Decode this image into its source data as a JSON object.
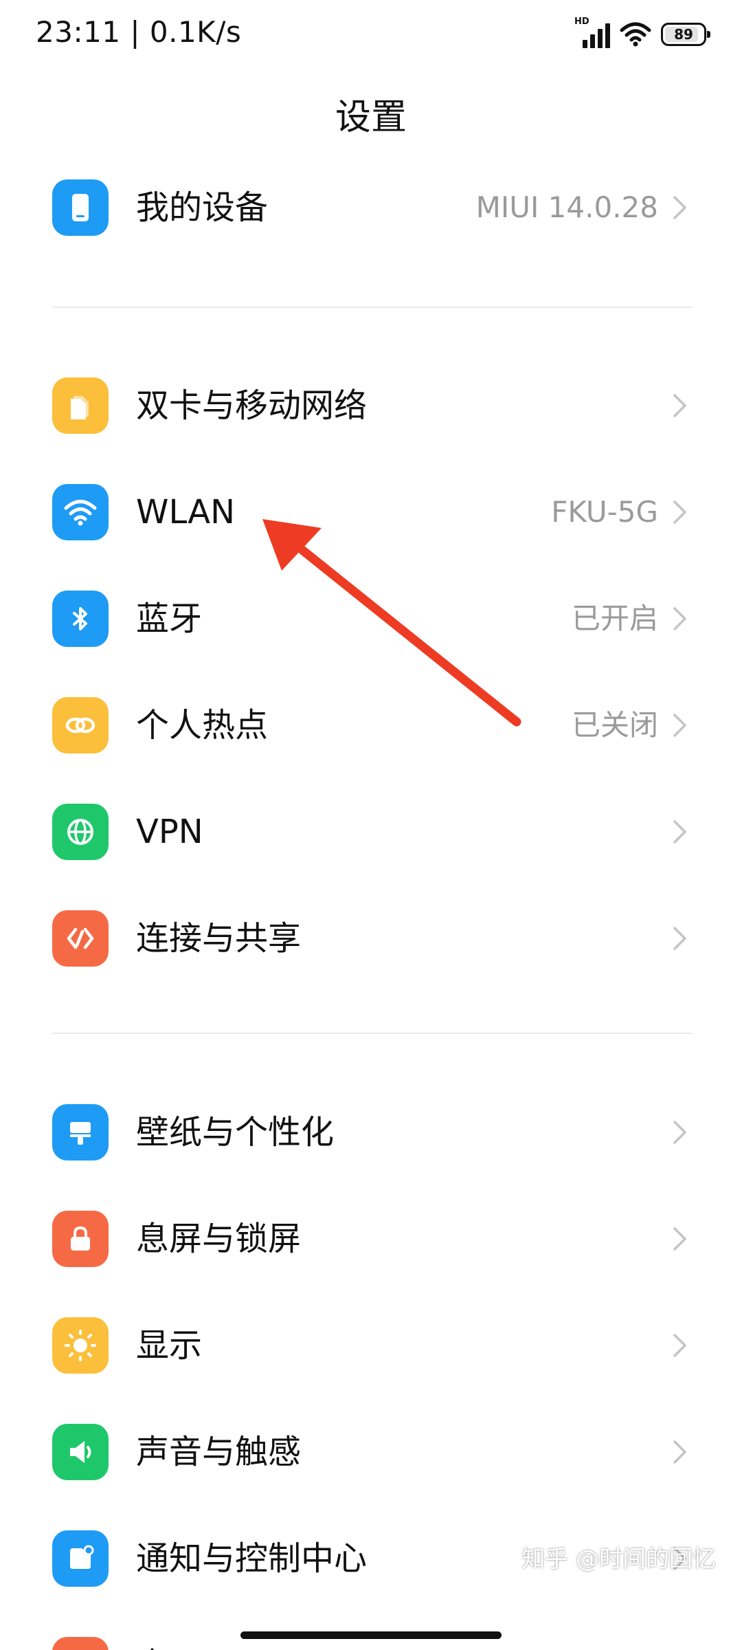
{
  "status_bar": {
    "time_speed": "23:11 | 0.1K/s",
    "network_label": "HD",
    "battery_level": "89",
    "battery_fraction": 0.89
  },
  "header": {
    "title": "设置"
  },
  "groups": [
    {
      "items": [
        {
          "id": "my-device",
          "label": "我的设备",
          "value": "MIUI 14.0.28",
          "icon": "phone-icon",
          "color": "#1E9BF5"
        }
      ]
    },
    {
      "items": [
        {
          "id": "sim-network",
          "label": "双卡与移动网络",
          "value": "",
          "icon": "sim-card-icon",
          "color": "#FBBF3C"
        },
        {
          "id": "wlan",
          "label": "WLAN",
          "value": "FKU-5G",
          "icon": "wifi-icon",
          "color": "#1E9BF5"
        },
        {
          "id": "bluetooth",
          "label": "蓝牙",
          "value": "已开启",
          "icon": "bluetooth-icon",
          "color": "#1E9BF5"
        },
        {
          "id": "hotspot",
          "label": "个人热点",
          "value": "已关闭",
          "icon": "hotspot-icon",
          "color": "#FBBF3C"
        },
        {
          "id": "vpn",
          "label": "VPN",
          "value": "",
          "icon": "globe-icon",
          "color": "#1EC86A"
        },
        {
          "id": "connection-sharing",
          "label": "连接与共享",
          "value": "",
          "icon": "share-link-icon",
          "color": "#F56A45"
        }
      ]
    },
    {
      "items": [
        {
          "id": "wallpaper",
          "label": "壁纸与个性化",
          "value": "",
          "icon": "brush-icon",
          "color": "#1E9BF5"
        },
        {
          "id": "lock-screen",
          "label": "息屏与锁屏",
          "value": "",
          "icon": "lock-icon",
          "color": "#F56A45"
        },
        {
          "id": "display",
          "label": "显示",
          "value": "",
          "icon": "sun-icon",
          "color": "#FBBF3C"
        },
        {
          "id": "sound",
          "label": "声音与触感",
          "value": "",
          "icon": "speaker-icon",
          "color": "#1EC86A"
        },
        {
          "id": "notifications",
          "label": "通知与控制中心",
          "value": "",
          "icon": "notification-icon",
          "color": "#1E9BF5"
        },
        {
          "id": "desktop",
          "label": "桌面",
          "value": "",
          "icon": "home-icon",
          "color": "#F56A45"
        }
      ]
    }
  ],
  "annotation": {
    "arrow_color": "#EE3B23"
  },
  "watermark": "知乎 @时间的回忆"
}
